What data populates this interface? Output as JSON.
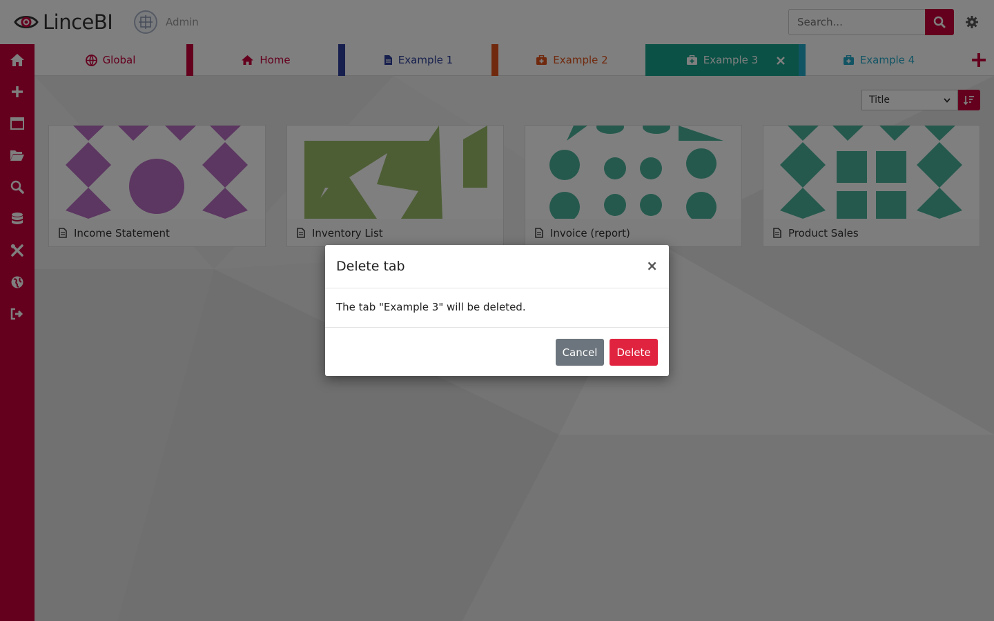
{
  "app": {
    "logo_text": "LinceBI",
    "user_name": "Admin"
  },
  "search": {
    "placeholder": "Search..."
  },
  "sidebar": {
    "items": [
      {
        "icon": "home-icon"
      },
      {
        "icon": "plus-icon"
      },
      {
        "icon": "window-icon"
      },
      {
        "icon": "folder-open-icon"
      },
      {
        "icon": "search-icon"
      },
      {
        "icon": "database-icon"
      },
      {
        "icon": "tools-icon"
      },
      {
        "icon": "globe-icon"
      },
      {
        "icon": "logout-icon"
      }
    ]
  },
  "tabs": [
    {
      "label": "Global",
      "icon": "globe-icon",
      "color": "#c8003c"
    },
    {
      "label": "Home",
      "icon": "home-icon",
      "color": "#c8003c"
    },
    {
      "label": "Example 1",
      "icon": "file-icon",
      "color": "#2c3e9a"
    },
    {
      "label": "Example 2",
      "icon": "briefcase-medical-icon",
      "color": "#e0531a"
    },
    {
      "label": "Example 3",
      "icon": "briefcase-medical-icon",
      "color": "#17a38c",
      "active": true
    },
    {
      "label": "Example 4",
      "icon": "briefcase-medical-icon",
      "color": "#22a9c8"
    }
  ],
  "toolbar": {
    "sort_value": "Title"
  },
  "cards": [
    {
      "title": "Income Statement",
      "color": "#b86fc2"
    },
    {
      "title": "Inventory List",
      "color": "#9bbd6a"
    },
    {
      "title": "Invoice (report)",
      "color": "#4cb39a"
    },
    {
      "title": "Product Sales",
      "color": "#4cb39a"
    }
  ],
  "modal": {
    "title": "Delete tab",
    "close": "×",
    "message": "The tab \"Example 3\" will be deleted.",
    "cancel_label": "Cancel",
    "delete_label": "Delete"
  },
  "colors": {
    "brand": "#c8003c",
    "cancel": "#6c757d",
    "delete": "#e0243f"
  }
}
